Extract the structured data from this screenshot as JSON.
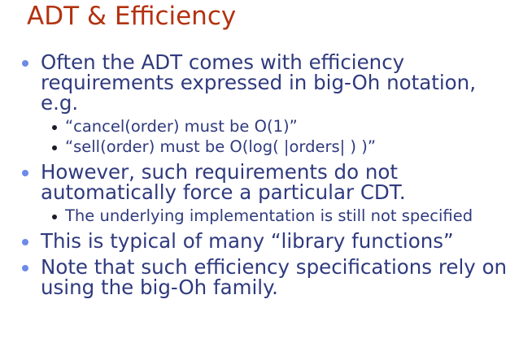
{
  "title": "ADT & Efficiency",
  "bullets": [
    {
      "text": "Often the ADT comes with efficiency requirements expressed in big-Oh notation, e.g.",
      "sub": [
        "“cancel(order) must be O(1)”",
        "“sell(order) must be O(log( |orders| ) )”"
      ]
    },
    {
      "text": "However, such requirements do not automatically force a particular CDT.",
      "sub": [
        "The underlying implementation is still not specified"
      ]
    },
    {
      "text": "This is typical of many “library functions”",
      "sub": []
    },
    {
      "text": "Note that such efficiency specifications rely on using the big-Oh family.",
      "sub": []
    }
  ],
  "colors": {
    "title": "#b3320f",
    "text": "#2f3a7e",
    "bullet": "#6d8ae8"
  }
}
